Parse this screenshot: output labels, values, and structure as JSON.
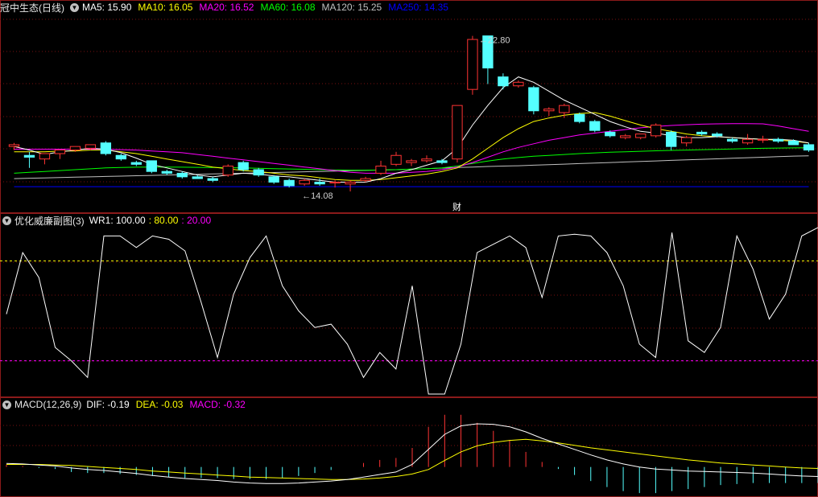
{
  "colors": {
    "up": "#ff3333",
    "down": "#54ffff",
    "ma5": "#ffffff",
    "ma10": "#ffff00",
    "ma20": "#ff00ff",
    "ma60": "#00ff00",
    "ma120": "#c0c0c0",
    "ma250": "#0000ff",
    "border": "#8b1a1a",
    "grid": "#7a1010"
  },
  "price_panel": {
    "stock": "冠中生态(日线)",
    "legend": [
      {
        "key": "ma5",
        "text": "MA5: 15.90"
      },
      {
        "key": "ma10",
        "text": "MA10: 16.05"
      },
      {
        "key": "ma20",
        "text": "MA20: 16.52"
      },
      {
        "key": "ma60",
        "text": "MA60: 16.08"
      },
      {
        "key": "ma120",
        "text": "MA120: 15.25"
      },
      {
        "key": "ma250",
        "text": "MA250: 14.35"
      }
    ],
    "max_label": "22.80",
    "min_label": "14.08",
    "event_mark": "财"
  },
  "wr_panel": {
    "title": "优化威廉副图(3)",
    "legend": [
      {
        "key": "ma5",
        "text": "WR1: 100.00"
      },
      {
        "key": "ma10",
        "text": ": 80.00"
      },
      {
        "key": "ma20",
        "text": ": 20.00"
      }
    ]
  },
  "macd_panel": {
    "title": "MACD(12,26,9)",
    "legend": [
      {
        "key": "ma5",
        "text": "DIF: -0.19"
      },
      {
        "key": "ma10",
        "text": "DEA: -0.03"
      },
      {
        "key": "ma20",
        "text": "MACD: -0.32"
      }
    ]
  },
  "chart_data": [
    {
      "type": "candlestick",
      "ylim": [
        13.0,
        24.0
      ],
      "grid": true,
      "ohlc": [
        [
          16.6,
          16.8,
          16.4,
          16.7
        ],
        [
          16.1,
          16.3,
          15.4,
          16.0
        ],
        [
          15.9,
          16.2,
          15.6,
          16.2
        ],
        [
          16.2,
          16.4,
          15.9,
          16.4
        ],
        [
          16.4,
          16.6,
          16.3,
          16.6
        ],
        [
          16.5,
          16.7,
          16.4,
          16.7
        ],
        [
          16.8,
          16.9,
          16.1,
          16.2
        ],
        [
          16.1,
          16.2,
          15.8,
          15.9
        ],
        [
          15.7,
          15.8,
          15.5,
          15.6
        ],
        [
          15.8,
          15.8,
          15.1,
          15.2
        ],
        [
          15.2,
          15.3,
          15.0,
          15.1
        ],
        [
          15.1,
          15.2,
          14.8,
          14.9
        ],
        [
          14.9,
          15.0,
          14.8,
          14.8
        ],
        [
          14.8,
          14.9,
          14.6,
          14.7
        ],
        [
          15.0,
          15.6,
          14.9,
          15.5
        ],
        [
          15.7,
          15.8,
          15.2,
          15.3
        ],
        [
          15.3,
          15.4,
          14.9,
          15.0
        ],
        [
          14.9,
          15.0,
          14.5,
          14.6
        ],
        [
          14.7,
          14.8,
          14.3,
          14.4
        ],
        [
          14.5,
          14.8,
          14.4,
          14.7
        ],
        [
          14.6,
          14.8,
          14.4,
          14.5
        ],
        [
          14.6,
          14.7,
          14.3,
          14.6
        ],
        [
          14.5,
          14.7,
          14.08,
          14.6
        ],
        [
          14.7,
          14.9,
          14.6,
          14.8
        ],
        [
          15.1,
          15.8,
          15.0,
          15.5
        ],
        [
          15.6,
          16.3,
          15.5,
          16.1
        ],
        [
          15.7,
          15.9,
          15.5,
          15.8
        ],
        [
          15.8,
          16.1,
          15.7,
          15.9
        ],
        [
          15.8,
          15.9,
          15.6,
          15.7
        ],
        [
          15.9,
          18.9,
          15.7,
          18.9
        ],
        [
          19.8,
          22.8,
          19.5,
          22.6
        ],
        [
          22.8,
          22.8,
          20.1,
          21.0
        ],
        [
          20.5,
          20.7,
          19.8,
          20.0
        ],
        [
          20.0,
          20.3,
          19.9,
          20.2
        ],
        [
          19.9,
          20.0,
          18.4,
          18.6
        ],
        [
          18.6,
          18.8,
          18.3,
          18.7
        ],
        [
          18.5,
          19.0,
          18.2,
          18.9
        ],
        [
          18.4,
          18.5,
          17.9,
          18.0
        ],
        [
          18.0,
          18.1,
          17.4,
          17.5
        ],
        [
          17.4,
          17.5,
          17.1,
          17.2
        ],
        [
          17.1,
          17.3,
          17.0,
          17.2
        ],
        [
          17.1,
          17.3,
          17.0,
          17.3
        ],
        [
          17.2,
          17.9,
          17.1,
          17.8
        ],
        [
          17.4,
          17.5,
          16.4,
          16.6
        ],
        [
          16.8,
          17.2,
          16.6,
          17.1
        ],
        [
          17.4,
          17.5,
          17.2,
          17.3
        ],
        [
          17.3,
          17.4,
          17.1,
          17.2
        ],
        [
          17.0,
          17.1,
          16.8,
          16.9
        ],
        [
          16.8,
          17.3,
          16.7,
          17.0
        ],
        [
          17.0,
          17.2,
          16.8,
          17.0
        ],
        [
          17.0,
          17.1,
          16.8,
          16.9
        ],
        [
          16.9,
          17.0,
          16.7,
          16.7
        ],
        [
          16.7,
          16.8,
          16.3,
          16.4
        ]
      ],
      "ma": {
        "ma5": [
          16.6,
          16.4,
          16.15,
          16.3,
          16.4,
          16.5,
          16.45,
          16.25,
          15.95,
          15.6,
          15.4,
          15.2,
          15.0,
          14.9,
          15.0,
          15.1,
          15.05,
          14.95,
          14.9,
          14.8,
          14.7,
          14.6,
          14.6,
          14.6,
          14.8,
          15.1,
          15.3,
          15.55,
          15.8,
          16.5,
          17.8,
          18.9,
          19.9,
          20.5,
          20.2,
          19.7,
          19.2,
          18.8,
          18.4,
          18.0,
          17.7,
          17.45,
          17.35,
          17.2,
          17.1,
          17.1,
          17.15,
          17.1,
          17.05,
          17.0,
          17.0,
          16.95,
          16.8
        ],
        "ma10": [
          16.3,
          16.3,
          16.3,
          16.35,
          16.35,
          16.4,
          16.4,
          16.3,
          16.2,
          16.05,
          15.9,
          15.75,
          15.6,
          15.45,
          15.35,
          15.25,
          15.2,
          15.1,
          15.0,
          14.95,
          14.85,
          14.75,
          14.7,
          14.7,
          14.75,
          14.85,
          14.95,
          15.05,
          15.2,
          15.4,
          15.9,
          16.5,
          17.1,
          17.6,
          18.0,
          18.2,
          18.35,
          18.45,
          18.5,
          18.3,
          18.05,
          17.8,
          17.6,
          17.45,
          17.3,
          17.2,
          17.15,
          17.1,
          17.05,
          17.0,
          16.95,
          16.9,
          16.8
        ],
        "ma20": [
          16.45,
          16.45,
          16.45,
          16.45,
          16.45,
          16.45,
          16.45,
          16.42,
          16.4,
          16.35,
          16.3,
          16.25,
          16.15,
          16.05,
          15.95,
          15.85,
          15.75,
          15.65,
          15.55,
          15.45,
          15.35,
          15.25,
          15.15,
          15.1,
          15.1,
          15.1,
          15.15,
          15.2,
          15.3,
          15.45,
          15.7,
          16.0,
          16.3,
          16.55,
          16.75,
          16.95,
          17.1,
          17.25,
          17.35,
          17.45,
          17.55,
          17.65,
          17.72,
          17.78,
          17.82,
          17.85,
          17.87,
          17.88,
          17.88,
          17.87,
          17.75,
          17.6,
          17.45
        ],
        "ma60": [
          15.1,
          15.15,
          15.2,
          15.25,
          15.3,
          15.35,
          15.4,
          15.42,
          15.44,
          15.45,
          15.45,
          15.44,
          15.43,
          15.42,
          15.41,
          15.4,
          15.38,
          15.36,
          15.34,
          15.32,
          15.3,
          15.28,
          15.27,
          15.27,
          15.28,
          15.3,
          15.33,
          15.36,
          15.4,
          15.5,
          15.65,
          15.78,
          15.9,
          15.98,
          16.05,
          16.1,
          16.15,
          16.2,
          16.24,
          16.28,
          16.3,
          16.33,
          16.36,
          16.38,
          16.4,
          16.42,
          16.44,
          16.46,
          16.48,
          16.5,
          16.51,
          16.52,
          16.53
        ],
        "ma120": [
          14.8,
          14.82,
          14.84,
          14.86,
          14.88,
          14.9,
          14.92,
          14.94,
          14.96,
          14.98,
          15.0,
          15.02,
          15.04,
          15.06,
          15.08,
          15.1,
          15.12,
          15.14,
          15.16,
          15.18,
          15.2,
          15.22,
          15.24,
          15.26,
          15.28,
          15.3,
          15.33,
          15.36,
          15.39,
          15.42,
          15.45,
          15.48,
          15.5,
          15.52,
          15.55,
          15.58,
          15.61,
          15.64,
          15.67,
          15.7,
          15.73,
          15.76,
          15.79,
          15.82,
          15.85,
          15.88,
          15.91,
          15.94,
          15.97,
          16.0,
          16.03,
          16.06,
          16.08
        ],
        "ma250": [
          14.35,
          14.35,
          14.35,
          14.35,
          14.35,
          14.35,
          14.35,
          14.35,
          14.35,
          14.35,
          14.35,
          14.35,
          14.35,
          14.35,
          14.35,
          14.35,
          14.35,
          14.35,
          14.35,
          14.35,
          14.35,
          14.35,
          14.35,
          14.35,
          14.35,
          14.35,
          14.35,
          14.35,
          14.35,
          14.35,
          14.35,
          14.35,
          14.35,
          14.35,
          14.35,
          14.35,
          14.35,
          14.35,
          14.35,
          14.35,
          14.35,
          14.35,
          14.35,
          14.35,
          14.35,
          14.35,
          14.35,
          14.35,
          14.35,
          14.35,
          14.35,
          14.35,
          14.35
        ]
      }
    },
    {
      "type": "line",
      "ylim": [
        0,
        100
      ],
      "levels": [
        80,
        20
      ],
      "wr1": [
        48,
        85,
        70,
        28,
        20,
        10,
        95,
        95,
        88,
        95,
        93,
        86,
        55,
        22,
        60,
        82,
        95,
        65,
        50,
        40,
        42,
        30,
        10,
        25,
        15,
        65,
        0,
        0,
        30,
        85,
        90,
        95,
        88,
        58,
        95,
        96,
        95,
        85,
        65,
        30,
        22,
        97,
        32,
        25,
        40,
        95,
        75,
        45,
        60,
        95,
        100
      ]
    },
    {
      "type": "bar+line",
      "ylim": [
        -0.55,
        1.1
      ],
      "grid": true,
      "dif": [
        0.07,
        0.06,
        0.04,
        0.02,
        -0.02,
        -0.05,
        -0.07,
        -0.1,
        -0.13,
        -0.17,
        -0.2,
        -0.23,
        -0.25,
        -0.27,
        -0.3,
        -0.32,
        -0.33,
        -0.33,
        -0.32,
        -0.3,
        -0.28,
        -0.25,
        -0.2,
        -0.15,
        -0.1,
        0.05,
        0.35,
        0.65,
        0.82,
        0.86,
        0.85,
        0.8,
        0.7,
        0.57,
        0.46,
        0.35,
        0.24,
        0.14,
        0.06,
        0.0,
        -0.04,
        -0.06,
        -0.08,
        -0.09,
        -0.1,
        -0.11,
        -0.12,
        -0.14,
        -0.16,
        -0.18,
        -0.19
      ],
      "dea": [
        0.05,
        0.05,
        0.05,
        0.04,
        0.03,
        0.01,
        -0.01,
        -0.03,
        -0.05,
        -0.08,
        -0.1,
        -0.12,
        -0.14,
        -0.16,
        -0.18,
        -0.2,
        -0.21,
        -0.22,
        -0.23,
        -0.24,
        -0.25,
        -0.25,
        -0.24,
        -0.22,
        -0.19,
        -0.14,
        -0.05,
        0.13,
        0.3,
        0.42,
        0.49,
        0.53,
        0.55,
        0.52,
        0.48,
        0.43,
        0.38,
        0.34,
        0.3,
        0.26,
        0.22,
        0.18,
        0.14,
        0.11,
        0.08,
        0.06,
        0.04,
        0.02,
        0.0,
        -0.02,
        -0.03
      ],
      "macd": [
        0.04,
        0.02,
        -0.02,
        -0.04,
        -0.1,
        -0.12,
        -0.12,
        -0.14,
        -0.16,
        -0.18,
        -0.2,
        -0.22,
        -0.22,
        -0.22,
        -0.24,
        -0.24,
        -0.24,
        -0.22,
        -0.18,
        -0.12,
        -0.06,
        0.0,
        0.08,
        0.14,
        0.18,
        0.38,
        0.8,
        1.04,
        1.04,
        0.88,
        0.72,
        0.54,
        0.3,
        0.1,
        -0.04,
        -0.16,
        -0.28,
        -0.4,
        -0.48,
        -0.52,
        -0.52,
        -0.48,
        -0.44,
        -0.4,
        -0.36,
        -0.34,
        -0.32,
        -0.32,
        -0.32,
        -0.32,
        -0.32
      ]
    }
  ]
}
